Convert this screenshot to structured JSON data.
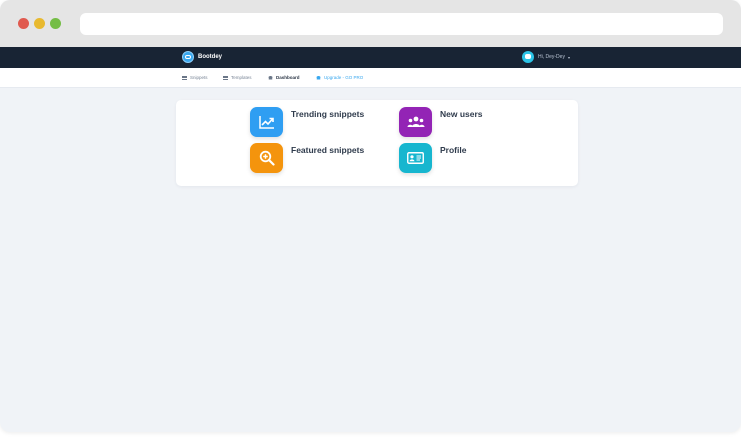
{
  "navbar": {
    "brand": "Bootdey",
    "user_label": "Hi, Dey-Dey",
    "caret": "▾"
  },
  "subnav": {
    "items": [
      {
        "label": "Snippets",
        "icon": "list-icon"
      },
      {
        "label": "Templates",
        "icon": "grid-icon"
      },
      {
        "label": "Dashboard",
        "icon": "home-icon",
        "active": true
      },
      {
        "label": "Upgrade - GO PRO",
        "icon": "upgrade-icon"
      }
    ]
  },
  "tiles": [
    {
      "label": "Trending snippets",
      "icon": "trending-chart-icon",
      "color": "#2f9ef2"
    },
    {
      "label": "New users",
      "icon": "users-icon",
      "color": "#9324b5"
    },
    {
      "label": "Featured snippets",
      "icon": "search-zoom-icon",
      "color": "#f4940d"
    },
    {
      "label": "Profile",
      "icon": "id-card-icon",
      "color": "#17b6cf"
    }
  ],
  "colors": {
    "navbar_bg": "#182434",
    "accent": "#3aa8ef",
    "page_bg": "#f0f3f7"
  }
}
